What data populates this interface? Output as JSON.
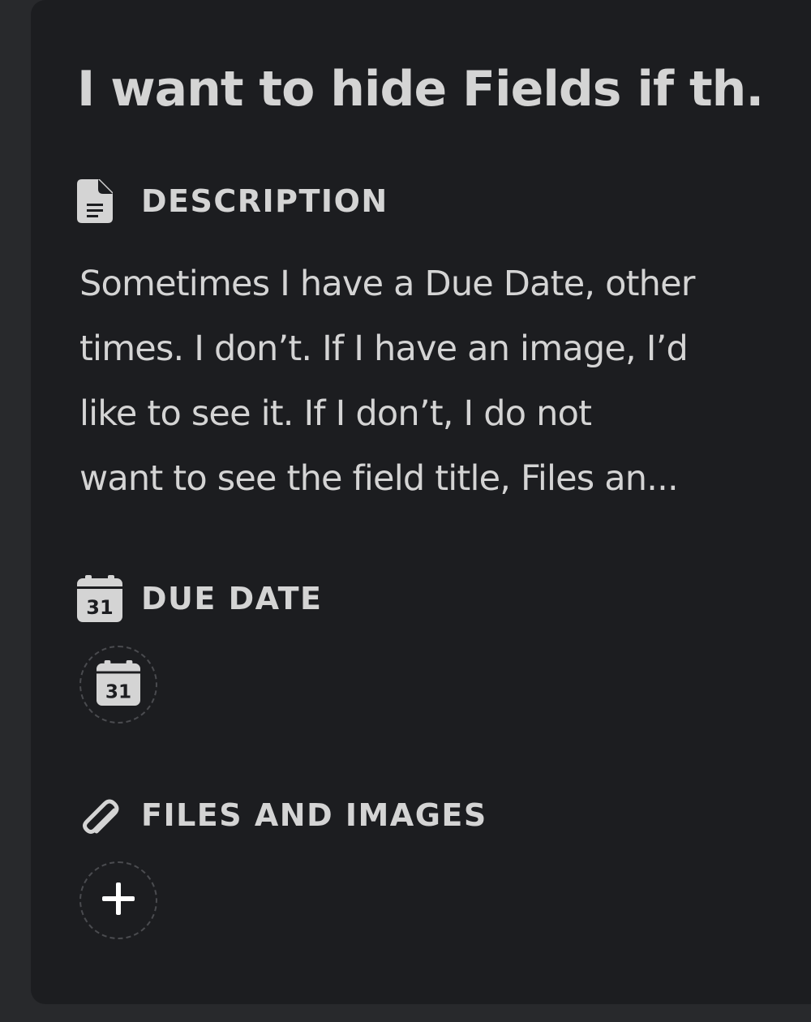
{
  "card": {
    "title": "I want to hide Fields if th...",
    "description": {
      "label": "DESCRIPTION",
      "icon": "document-icon",
      "lines": [
        "Sometimes I have a Due Date, other",
        "times. I don’t. If I have an image, I’d",
        "like to see it. If I don’t, I do not",
        "want to see the field title, Files an..."
      ]
    },
    "due_date": {
      "label": "DUE DATE",
      "icon": "calendar-icon",
      "icon_text": "31",
      "button_icon": "calendar-icon"
    },
    "files": {
      "label": "FILES AND IMAGES",
      "icon": "paperclip-icon",
      "button_icon": "plus-icon"
    }
  },
  "colors": {
    "page_background": "#28292c",
    "card_background": "#1c1d20",
    "text": "#d4d4d4",
    "dashed_border": "#4a4b4f"
  }
}
